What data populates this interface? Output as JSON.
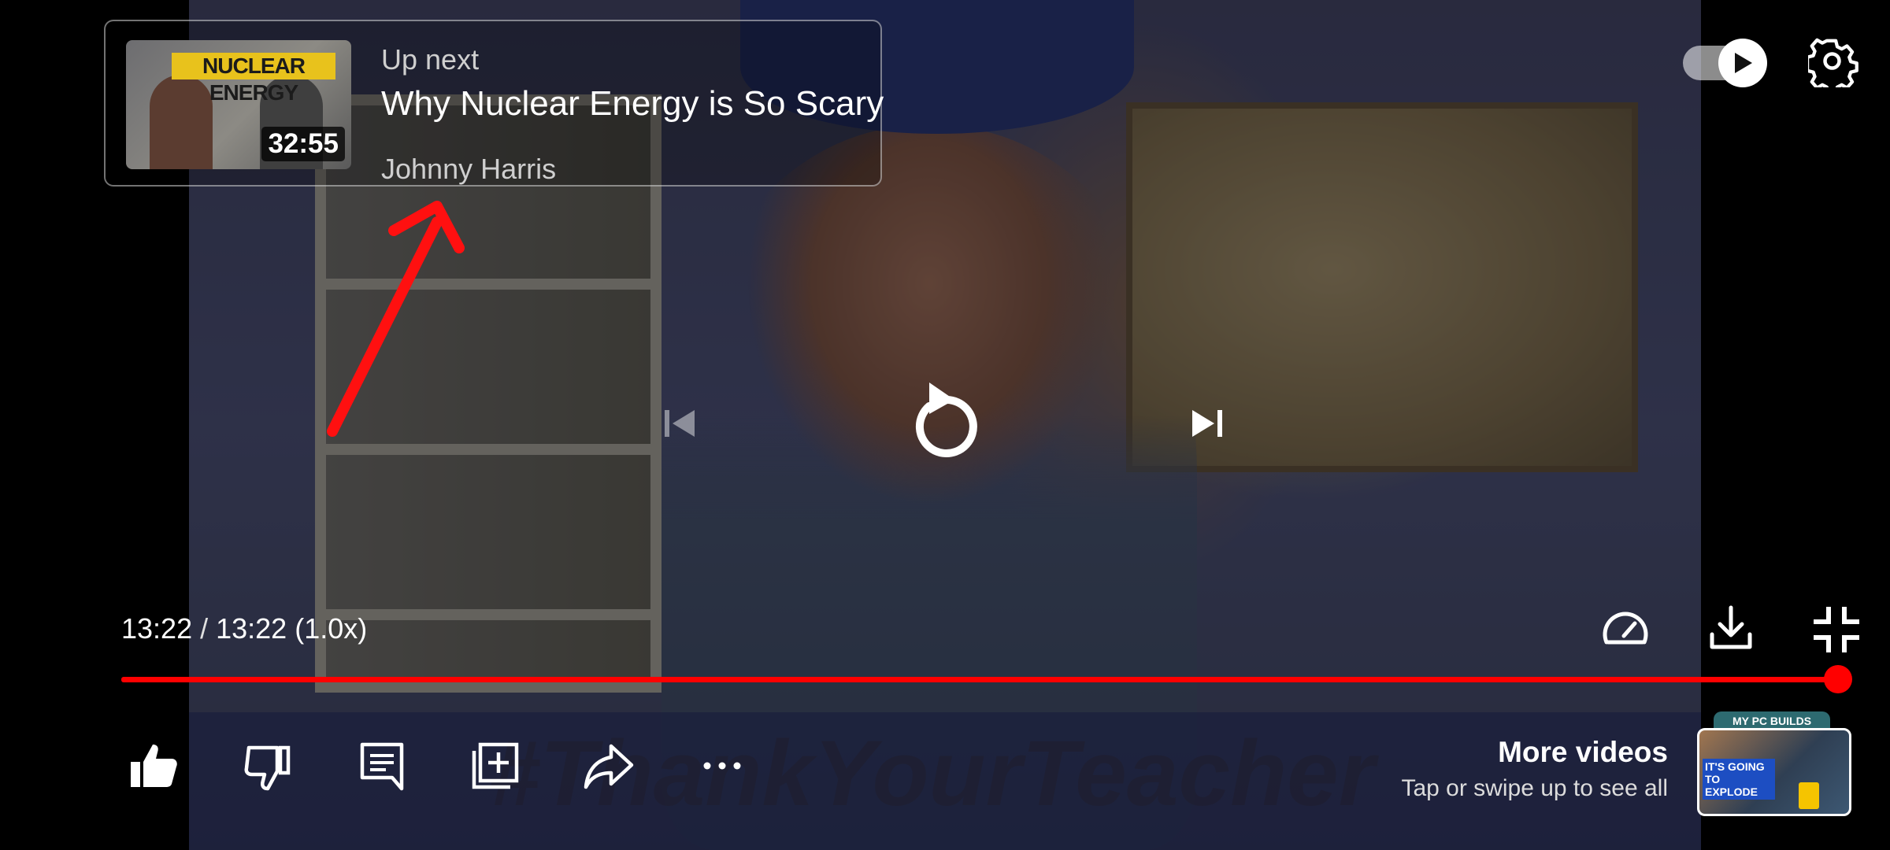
{
  "up_next": {
    "label": "Up next",
    "title": "Why Nuclear Energy is So Scary",
    "channel": "Johnny Harris",
    "thumbnail_text": "NUCLEAR ENERGY",
    "duration": "32:55"
  },
  "overlay_text": "#ThankYourTeacher",
  "player": {
    "current_time": "13:22",
    "separator": " / ",
    "total_time": "13:22",
    "speed": " (1.0x)",
    "progress": 1.0,
    "autoplay_on": true
  },
  "more_videos": {
    "title": "More videos",
    "subtitle": "Tap or swipe up to see all",
    "thumbnail_top": "MY PC BUILDS",
    "thumbnail_label": "IT'S GOING TO EXPLODE"
  },
  "icons": {
    "top_right": [
      "autoplay-toggle",
      "settings-icon"
    ],
    "center": [
      "previous-icon",
      "replay-icon",
      "next-icon"
    ],
    "bottom_right": [
      "playback-speed-icon",
      "download-icon",
      "exit-fullscreen-icon"
    ],
    "actions": [
      "like-icon",
      "dislike-icon",
      "comments-icon",
      "save-to-playlist-icon",
      "share-icon",
      "more-icon"
    ]
  },
  "colors": {
    "progress": "#ff0000",
    "annotation_arrow": "#ff1010"
  }
}
